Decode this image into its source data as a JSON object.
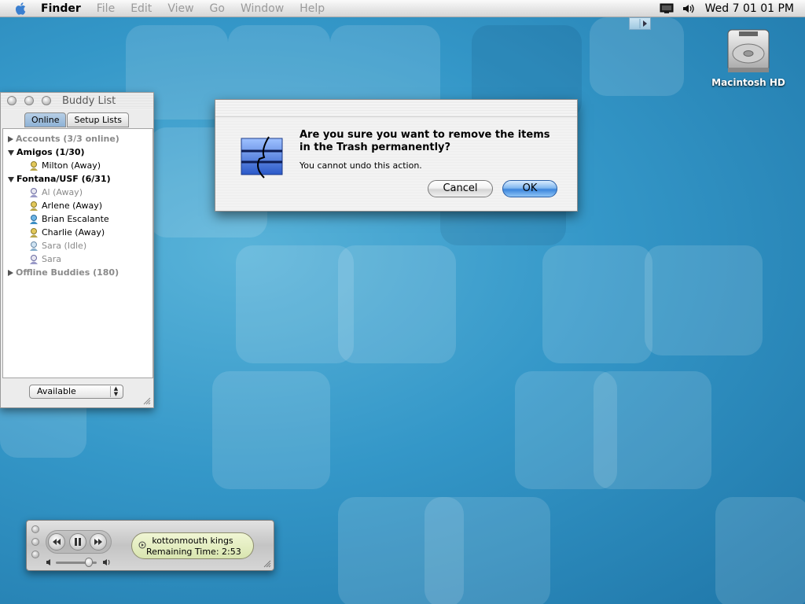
{
  "menubar": {
    "app_name": "Finder",
    "items": [
      "File",
      "Edit",
      "View",
      "Go",
      "Window",
      "Help"
    ],
    "clock": "Wed 7 01 01 PM"
  },
  "desktop": {
    "disk_label": "Macintosh HD"
  },
  "buddy_list": {
    "title": "Buddy List",
    "tabs": [
      "Online",
      "Setup Lists"
    ],
    "active_tab": "Online",
    "rows": [
      {
        "type": "group",
        "label": "Accounts (3/3 online)",
        "expanded": false,
        "dimmed": true
      },
      {
        "type": "group",
        "label": "Amigos (1/30)",
        "expanded": true,
        "dimmed": false
      },
      {
        "type": "buddy",
        "label": "Milton (Away)",
        "dimmed": false
      },
      {
        "type": "group",
        "label": "Fontana/USF (6/31)",
        "expanded": true,
        "dimmed": false
      },
      {
        "type": "buddy",
        "label": "Al (Away)",
        "dimmed": true
      },
      {
        "type": "buddy",
        "label": "Arlene (Away)",
        "dimmed": false
      },
      {
        "type": "buddy",
        "label": "Brian Escalante",
        "dimmed": false
      },
      {
        "type": "buddy",
        "label": "Charlie (Away)",
        "dimmed": false
      },
      {
        "type": "buddy",
        "label": "Sara (Idle)",
        "dimmed": true
      },
      {
        "type": "buddy",
        "label": "Sara",
        "dimmed": true
      },
      {
        "type": "group",
        "label": "Offline Buddies (180)",
        "expanded": false,
        "dimmed": true
      }
    ],
    "status": "Available"
  },
  "dialog": {
    "message": "Are you sure you want to remove the items in the Trash permanently?",
    "detail": "You cannot undo this action.",
    "cancel_label": "Cancel",
    "ok_label": "OK"
  },
  "itunes": {
    "song": "kottonmouth kings",
    "remaining": "Remaining Time: 2:53",
    "volume": 0.8
  },
  "colors": {
    "desktop": "#2f8fc0",
    "ok_button": "#3c86dc"
  }
}
